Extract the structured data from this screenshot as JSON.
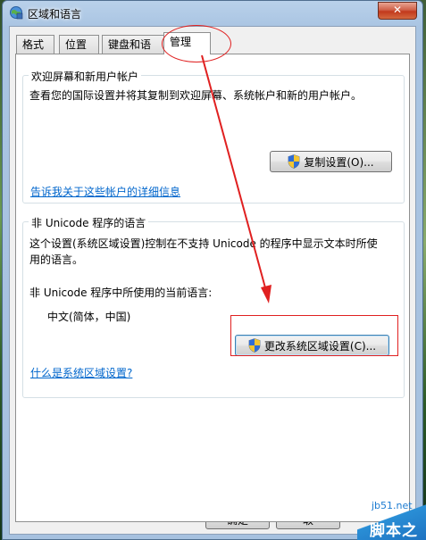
{
  "window": {
    "title": "区域和语言",
    "close_label": "✕"
  },
  "tabs": [
    {
      "label": "格式",
      "active": false
    },
    {
      "label": "位置",
      "active": false
    },
    {
      "label": "键盘和语言",
      "active": false
    },
    {
      "label": "管理",
      "active": true
    }
  ],
  "welcome_group": {
    "title": "欢迎屏幕和新用户帐户",
    "description": "查看您的国际设置并将其复制到欢迎屏幕、系统帐户和新的用户帐户。",
    "copy_button": "复制设置(O)...",
    "link": "告诉我关于这些帐户的详细信息"
  },
  "unicode_group": {
    "title": "非 Unicode 程序的语言",
    "description_line1": "这个设置(系统区域设置)控制在不支持 Unicode 的程序中显示文本时所使",
    "description_line2": "用的语言。",
    "current_label": "非 Unicode 程序中所使用的当前语言:",
    "current_value": "中文(简体，中国)",
    "change_button": "更改系统区域设置(C)...",
    "link": "什么是系统区域设置?"
  },
  "footer": {
    "ok_button": "确定",
    "cancel_button_partial": "取"
  },
  "watermark": {
    "url": "jb51.net",
    "name": "脚本之家"
  },
  "colors": {
    "annotation_red": "#e02020",
    "link_blue": "#0066cc"
  }
}
